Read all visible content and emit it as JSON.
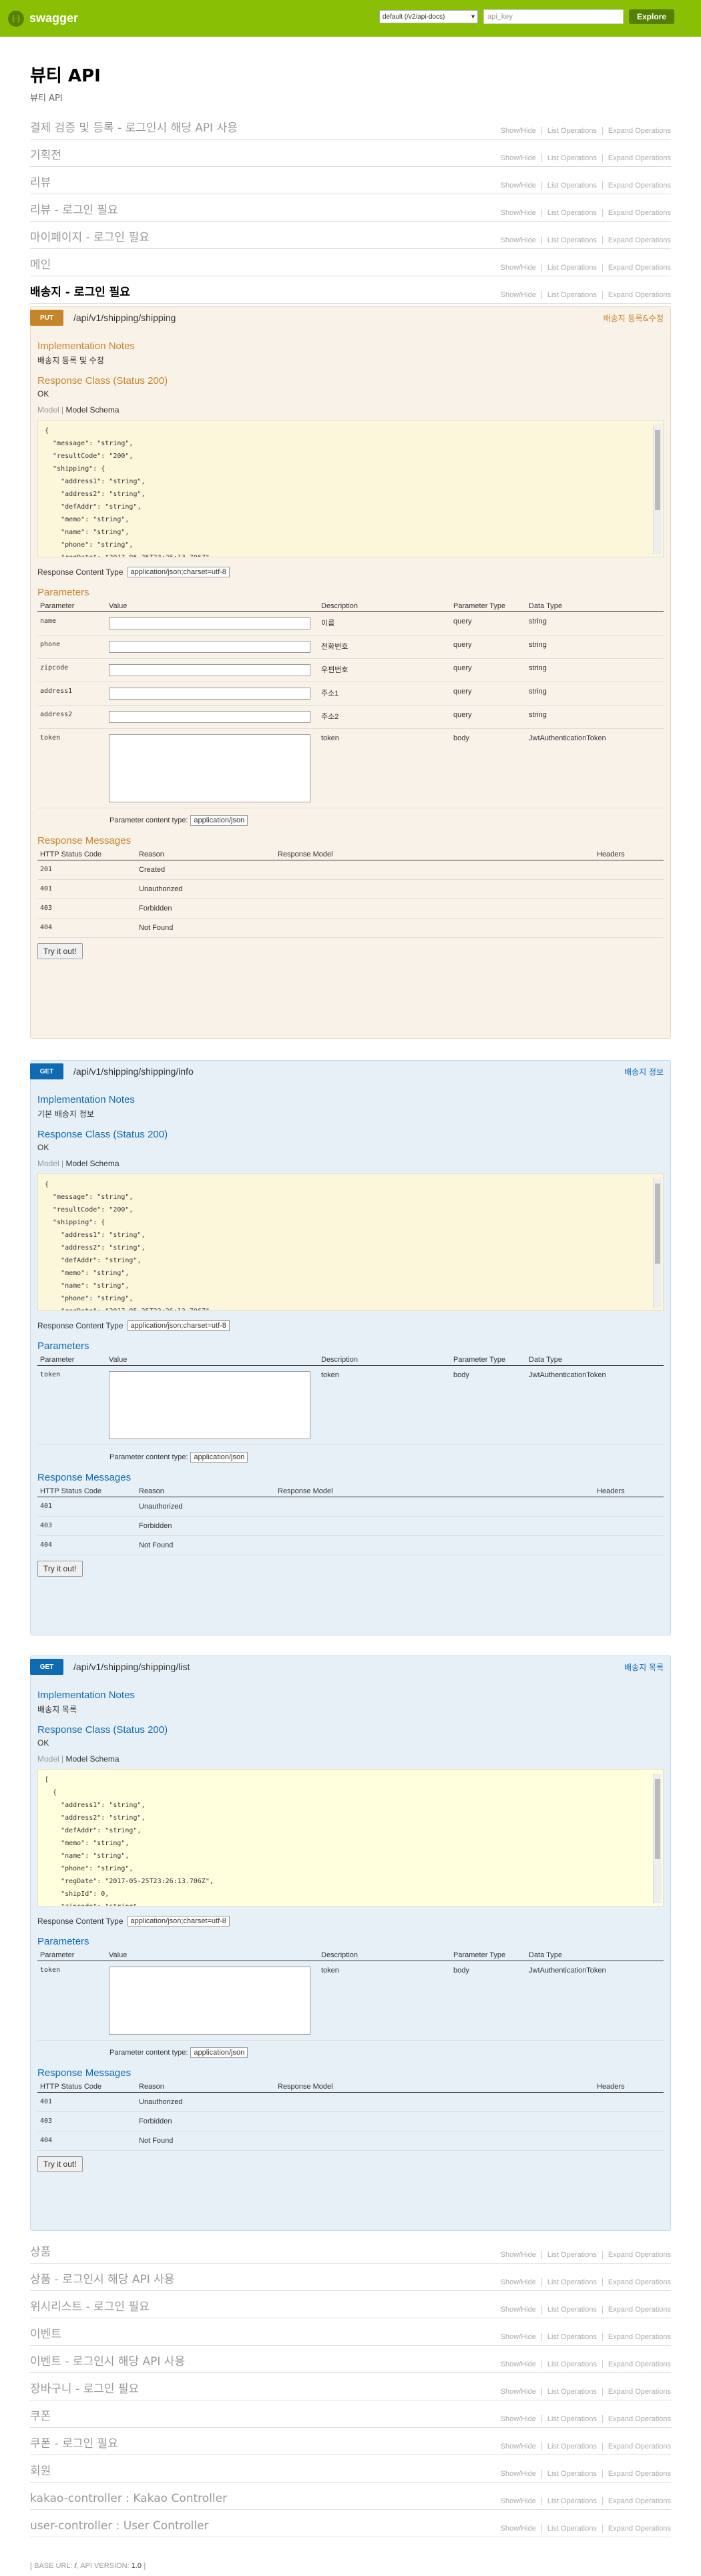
{
  "header": {
    "brand": "swagger",
    "logo_glyph": "{-}",
    "spec_select": "default (/v2/api-docs)",
    "api_key_placeholder": "api_key",
    "explore_label": "Explore"
  },
  "info": {
    "title": "뷰티 API",
    "description": "뷰티 API"
  },
  "resource_links": {
    "show_hide": "Show/Hide",
    "list_ops": "List Operations",
    "expand_ops": "Expand Operations"
  },
  "resources_top": [
    "결제 검증 및 등록 - 로그인시 해당 API 사용",
    "기획전",
    "리뷰",
    "리뷰 - 로그인 필요",
    "마이페이지 - 로그인 필요",
    "메인",
    "배송지 - 로그인 필요"
  ],
  "resources_bottom": [
    "상품",
    "상품 - 로그인시 해당 API 사용",
    "위시리스트 - 로그인 필요",
    "이벤트",
    "이벤트 - 로그인시 해당 API 사용",
    "장바구니 - 로그인 필요",
    "쿠폰",
    "쿠폰 - 로그인 필요",
    "회원",
    "kakao-controller : Kakao Controller",
    "user-controller : User Controller"
  ],
  "labels": {
    "impl_notes": "Implementation Notes",
    "response_class": "Response Class (Status 200)",
    "ok": "OK",
    "model": "Model",
    "model_schema": "Model Schema",
    "response_content_type": "Response Content Type",
    "content_type_value": "application/json;charset=utf-8",
    "parameters": "Parameters",
    "param_headers": [
      "Parameter",
      "Value",
      "Description",
      "Parameter Type",
      "Data Type"
    ],
    "param_content_type": "Parameter content type:",
    "param_content_type_value": "application/json",
    "response_messages": "Response Messages",
    "resp_headers": [
      "HTTP Status Code",
      "Reason",
      "Response Model",
      "Headers"
    ],
    "try_it": "Try it out!"
  },
  "ops": [
    {
      "method": "PUT",
      "path": "/api/v1/shipping/shipping",
      "summary": "배송지 등록&수정",
      "notes": "배송지 등록 및 수정",
      "schema": "{\n  \"message\": \"string\",\n  \"resultCode\": \"200\",\n  \"shipping\": {\n    \"address1\": \"string\",\n    \"address2\": \"string\",\n    \"defAddr\": \"string\",\n    \"memo\": \"string\",\n    \"name\": \"string\",\n    \"phone\": \"string\",\n    \"regDate\": \"2017-05-25T23:26:13.706Z\",",
      "params": [
        {
          "name": "name",
          "desc": "이름",
          "type": "query",
          "dtype": "string"
        },
        {
          "name": "phone",
          "desc": "전화번호",
          "type": "query",
          "dtype": "string"
        },
        {
          "name": "zipcode",
          "desc": "우편번호",
          "type": "query",
          "dtype": "string"
        },
        {
          "name": "address1",
          "desc": "주소1",
          "type": "query",
          "dtype": "string"
        },
        {
          "name": "address2",
          "desc": "주소2",
          "type": "query",
          "dtype": "string"
        },
        {
          "name": "token",
          "desc": "token",
          "type": "body",
          "dtype": "JwtAuthenticationToken"
        }
      ],
      "responses": [
        {
          "code": "201",
          "reason": "Created"
        },
        {
          "code": "401",
          "reason": "Unauthorized"
        },
        {
          "code": "403",
          "reason": "Forbidden"
        },
        {
          "code": "404",
          "reason": "Not Found"
        }
      ]
    },
    {
      "method": "GET",
      "path": "/api/v1/shipping/shipping/info",
      "summary": "배송지 정보",
      "notes": "기본 배송지 정보",
      "schema": "{\n  \"message\": \"string\",\n  \"resultCode\": \"200\",\n  \"shipping\": {\n    \"address1\": \"string\",\n    \"address2\": \"string\",\n    \"defAddr\": \"string\",\n    \"memo\": \"string\",\n    \"name\": \"string\",\n    \"phone\": \"string\",\n    \"regDate\": \"2017-05-25T23:26:13.706Z\",",
      "params": [
        {
          "name": "token",
          "desc": "token",
          "type": "body",
          "dtype": "JwtAuthenticationToken"
        }
      ],
      "responses": [
        {
          "code": "401",
          "reason": "Unauthorized"
        },
        {
          "code": "403",
          "reason": "Forbidden"
        },
        {
          "code": "404",
          "reason": "Not Found"
        }
      ]
    },
    {
      "method": "GET",
      "path": "/api/v1/shipping/shipping/list",
      "summary": "배송지 목록",
      "notes": "배송지 목록",
      "schema": "[\n  {\n    \"address1\": \"string\",\n    \"address2\": \"string\",\n    \"defAddr\": \"string\",\n    \"memo\": \"string\",\n    \"name\": \"string\",\n    \"phone\": \"string\",\n    \"regDate\": \"2017-05-25T23:26:13.706Z\",\n    \"shipId\": 0,\n    \"zipcode\": \"string\"",
      "params": [
        {
          "name": "token",
          "desc": "token",
          "type": "body",
          "dtype": "JwtAuthenticationToken"
        }
      ],
      "responses": [
        {
          "code": "401",
          "reason": "Unauthorized"
        },
        {
          "code": "403",
          "reason": "Forbidden"
        },
        {
          "code": "404",
          "reason": "Not Found"
        }
      ]
    }
  ],
  "footer": {
    "base_url_label": "BASE URL:",
    "base_url": "/",
    "api_version_label": "API VERSION:",
    "api_version": "1.0"
  },
  "colors": {
    "header": "#89bf04",
    "put": "#c5862b",
    "get": "#0f6ab4"
  }
}
